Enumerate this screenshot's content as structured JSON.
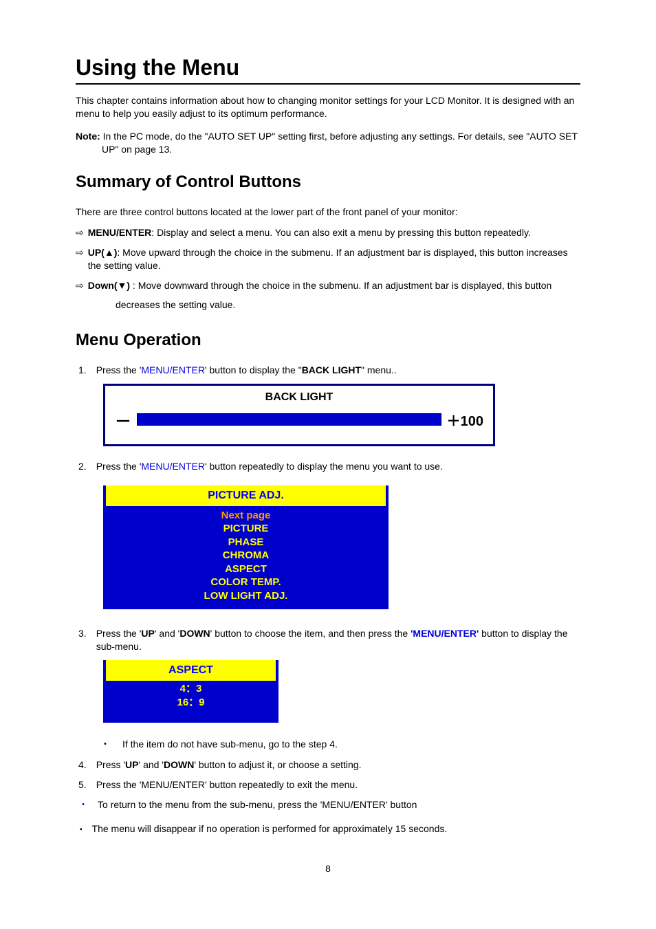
{
  "title": "Using the Menu",
  "intro": "This chapter contains information about how to changing monitor settings for your LCD Monitor. It is designed with an menu to help you easily adjust to its optimum performance.",
  "note_label": "Note:",
  "note_text": " In the PC mode, do the \"AUTO SET UP\" setting first, before adjusting any settings. For details, see \"AUTO SET UP\" on page 13.",
  "summary_heading": "Summary of Control Buttons",
  "summary_intro": "There are three control buttons located at the lower part of the front panel of your monitor:",
  "buttons": {
    "menu_enter": {
      "label": "MENU/ENTER",
      "desc": ": Display and select a menu. You can also exit a menu by pressing this button repeatedly."
    },
    "up": {
      "label": "UP(▲)",
      "desc": ": Move upward through the choice in the submenu. If an adjustment bar is displayed, this button increases the setting value."
    },
    "down": {
      "label": "Down(▼)",
      "desc_part1": " : Move downward through the choice in the submenu. If an adjustment bar is displayed, this button",
      "desc_part2": "decreases the setting value."
    }
  },
  "menu_op_heading": "Menu Operation",
  "step1": {
    "pre": "Press the '",
    "link": "MENU/ENTER",
    "mid": "' button to display the \"",
    "bold": "BACK LIGHT",
    "post": "\" menu.."
  },
  "backlight": {
    "title": "BACK LIGHT",
    "minus": "－",
    "value": "＋100"
  },
  "step2": {
    "pre": "Press the '",
    "link": "MENU/ENTER",
    "post": "' button repeatedly to display the menu you want to use."
  },
  "picture_menu": {
    "header": "PICTURE ADJ.",
    "items": [
      "Next page",
      "PICTURE",
      "PHASE",
      "CHROMA",
      "ASPECT",
      "COLOR TEMP.",
      "LOW LIGHT ADJ."
    ]
  },
  "step3": {
    "pre": "Press the '",
    "b1": "UP",
    "mid1": "' and '",
    "b2": "DOWN",
    "mid2": "' button to choose the item, and then press the ",
    "link": "'MENU/ENTER'",
    "post": " button to display the sub-menu."
  },
  "aspect_menu": {
    "header": "ASPECT",
    "items": [
      "4：3",
      "16：9"
    ]
  },
  "bullet_sub": "If the item do not have sub-menu, go to the step 4.",
  "step4": {
    "pre": "Press '",
    "b1": "UP",
    "mid1": "' and '",
    "b2": "DOWN",
    "post": "' button to adjust it, or choose a setting."
  },
  "step5": "Press the 'MENU/ENTER' button repeatedly to exit the menu.",
  "bullet_return": "To return to the menu from the sub-menu, press the 'MENU/ENTER' button",
  "square_note": "The menu will disappear if no operation is performed for approximately 15 seconds.",
  "page_number": "8",
  "arrow_glyph": "⇨",
  "dot_glyph": "・",
  "square_glyph": "▪"
}
